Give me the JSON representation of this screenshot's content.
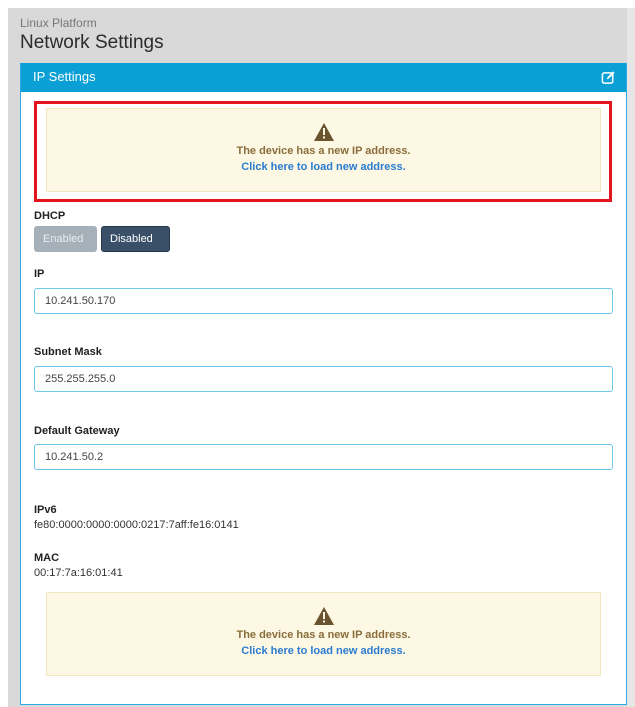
{
  "header": {
    "platform": "Linux Platform",
    "title": "Network Settings"
  },
  "panel": {
    "title": "IP Settings",
    "edit_icon": "edit-icon"
  },
  "alert_top": {
    "icon": "warning-icon",
    "message": "The device has a new IP address.",
    "link": "Click here to load new address."
  },
  "dhcp": {
    "label": "DHCP",
    "enabled_label": "Enabled",
    "disabled_label": "Disabled",
    "selected": "Disabled"
  },
  "ip": {
    "label": "IP",
    "value": "10.241.50.170"
  },
  "subnet": {
    "label": "Subnet Mask",
    "value": "255.255.255.0"
  },
  "gateway": {
    "label": "Default Gateway",
    "value": "10.241.50.2"
  },
  "ipv6": {
    "label": "IPv6",
    "value": "fe80:0000:0000:0000:0217:7aff:fe16:0141"
  },
  "mac": {
    "label": "MAC",
    "value": "00:17:7a:16:01:41"
  },
  "alert_bottom": {
    "icon": "warning-icon",
    "message": "The device has a new IP address.",
    "link": "Click here to load new address."
  },
  "colors": {
    "header_blue": "#0aa0d6",
    "alert_bg": "#fcf8e3",
    "alert_text": "#8a6d3b",
    "link_blue": "#2a7bd0",
    "highlight_red": "#e3141b",
    "disabled_button": "#3a5068"
  }
}
